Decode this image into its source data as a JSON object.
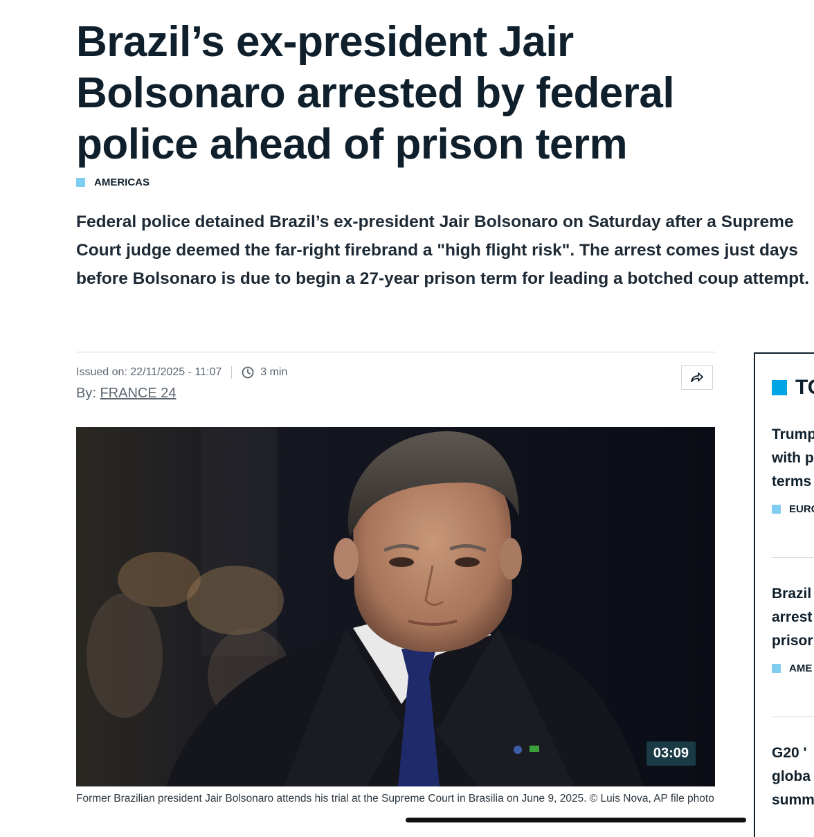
{
  "article": {
    "headline": "Brazil’s ex-president Jair Bolsonaro arrested by federal police ahead of prison term",
    "category": "AMERICAS",
    "lead": "Federal police detained Brazil’s ex-president Jair Bolsonaro on Saturday after a Supreme Court judge deemed the far-right firebrand a \"high flight risk\". The arrest comes just days before Bolsonaro is due to begin a 27-year prison term for leading a botched coup attempt.",
    "issued": "Issued on: 22/11/2025 - 11:07",
    "read_time": "3 min",
    "byline_prefix": "By:",
    "author": "FRANCE 24",
    "video_duration": "03:09",
    "caption": "Former Brazilian president Jair Bolsonaro attends his trial at the Supreme Court in Brasilia on June 9, 2025.  © Luis Nova, AP file photo"
  },
  "sidebar": {
    "heading": "TO",
    "stories": [
      {
        "title_lines": [
          "Trump",
          "with p",
          "terms"
        ],
        "category": "EURO"
      },
      {
        "title_lines": [
          "Brazil",
          "arrest",
          "prisor"
        ],
        "category": "AME"
      },
      {
        "title_lines": [
          "G20 '",
          "globa",
          "summ"
        ],
        "category": ""
      }
    ]
  },
  "icons": {
    "clock": "clock-icon",
    "share": "share-icon",
    "category_marker": "square-marker-icon"
  },
  "colors": {
    "accent_blue": "#00a5e6",
    "category_marker": "#7fcdf0",
    "text_dark": "#0f1f2b",
    "duration_badge": "#1a3a46"
  }
}
